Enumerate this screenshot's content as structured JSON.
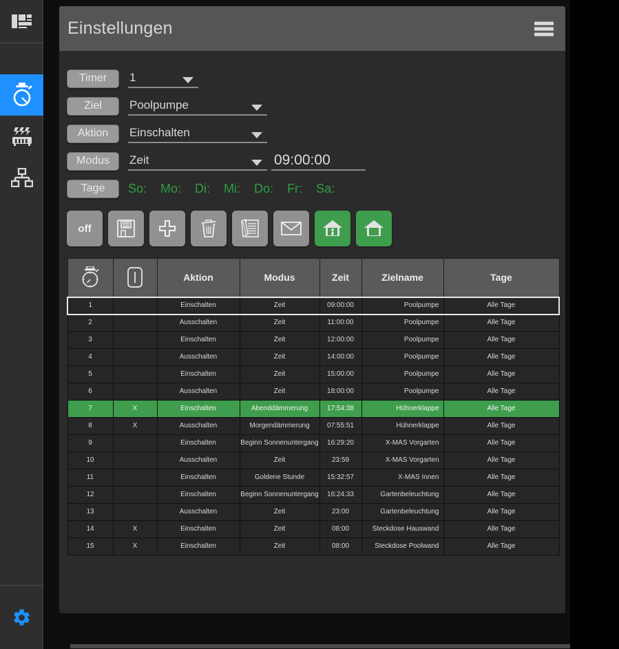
{
  "rail": {
    "items": [
      {
        "name": "dashboard",
        "icon": "dashboard-icon",
        "active": false
      },
      {
        "name": "timer",
        "icon": "stopwatch-icon",
        "active": true
      },
      {
        "name": "heating",
        "icon": "radiator-icon",
        "active": false
      },
      {
        "name": "network",
        "icon": "sitemap-icon",
        "active": false
      }
    ],
    "settings_icon": "gear-icon"
  },
  "header": {
    "title": "Einstellungen",
    "menu_icon": "hamburger-menu-icon"
  },
  "form": {
    "timer": {
      "label": "Timer",
      "value": "1"
    },
    "ziel": {
      "label": "Ziel",
      "value": "Poolpumpe"
    },
    "aktion": {
      "label": "Aktion",
      "value": "Einschalten"
    },
    "modus": {
      "label": "Modus",
      "value": "Zeit",
      "time": "09:00:00"
    },
    "tage": {
      "label": "Tage",
      "days": [
        "So:",
        "Mo:",
        "Di:",
        "Mi:",
        "Do:",
        "Fr:",
        "Sa:"
      ]
    }
  },
  "buttons": [
    {
      "name": "power-off-button",
      "label": "off",
      "icon": "text-off",
      "green": false
    },
    {
      "name": "save-button",
      "label": "",
      "icon": "floppy-disk-icon",
      "green": false
    },
    {
      "name": "add-button",
      "label": "",
      "icon": "plus-icon",
      "green": false
    },
    {
      "name": "delete-button",
      "label": "",
      "icon": "trash-icon",
      "green": false
    },
    {
      "name": "edit-log-button",
      "label": "",
      "icon": "notepad-pencil-icon",
      "green": false
    },
    {
      "name": "mail-button",
      "label": "",
      "icon": "envelope-icon",
      "green": false
    },
    {
      "name": "presence-home-button",
      "label": "",
      "icon": "house-person-icon",
      "green": true
    },
    {
      "name": "away-home-button",
      "label": "",
      "icon": "house-icon",
      "green": true
    }
  ],
  "table": {
    "headers": [
      "",
      "",
      "Aktion",
      "Modus",
      "Zeit",
      "Zielname",
      "Tage"
    ],
    "header_icons": [
      "stopwatch-icon",
      "switch-icon",
      "",
      "",
      "",
      "",
      ""
    ],
    "rows": [
      {
        "id": "1",
        "flag": "",
        "aktion": "Einschalten",
        "modus": "Zeit",
        "zeit": "09:00:00",
        "ziel": "Poolpumpe",
        "tage": "Alle Tage",
        "green": false,
        "selected": true
      },
      {
        "id": "2",
        "flag": "",
        "aktion": "Ausschalten",
        "modus": "Zeit",
        "zeit": "11:00:00",
        "ziel": "Poolpumpe",
        "tage": "Alle Tage",
        "green": false,
        "selected": false
      },
      {
        "id": "3",
        "flag": "",
        "aktion": "Einschalten",
        "modus": "Zeit",
        "zeit": "12:00:00",
        "ziel": "Poolpumpe",
        "tage": "Alle Tage",
        "green": false,
        "selected": false
      },
      {
        "id": "4",
        "flag": "",
        "aktion": "Ausschalten",
        "modus": "Zeit",
        "zeit": "14:00:00",
        "ziel": "Poolpumpe",
        "tage": "Alle Tage",
        "green": false,
        "selected": false
      },
      {
        "id": "5",
        "flag": "",
        "aktion": "Einschalten",
        "modus": "Zeit",
        "zeit": "15:00:00",
        "ziel": "Poolpumpe",
        "tage": "Alle Tage",
        "green": false,
        "selected": false
      },
      {
        "id": "6",
        "flag": "",
        "aktion": "Ausschalten",
        "modus": "Zeit",
        "zeit": "18:00:00",
        "ziel": "Poolpumpe",
        "tage": "Alle Tage",
        "green": false,
        "selected": false
      },
      {
        "id": "7",
        "flag": "X",
        "aktion": "Einschalten",
        "modus": "Abenddämmerung",
        "zeit": "17:54:38",
        "ziel": "Hühnerklappe",
        "tage": "Alle Tage",
        "green": true,
        "selected": false
      },
      {
        "id": "8",
        "flag": "X",
        "aktion": "Ausschalten",
        "modus": "Morgendämmerung",
        "zeit": "07:55:51",
        "ziel": "Hühnerklappe",
        "tage": "Alle Tage",
        "green": false,
        "selected": false
      },
      {
        "id": "9",
        "flag": "",
        "aktion": "Einschalten",
        "modus": "Beginn Sonnenuntergang",
        "zeit": "16:29:20",
        "ziel": "X-MAS Vorgarten",
        "tage": "Alle Tage",
        "green": false,
        "selected": false
      },
      {
        "id": "10",
        "flag": "",
        "aktion": "Ausschalten",
        "modus": "Zeit",
        "zeit": "23:59",
        "ziel": "X-MAS Vorgarten",
        "tage": "Alle Tage",
        "green": false,
        "selected": false
      },
      {
        "id": "11",
        "flag": "",
        "aktion": "Einschalten",
        "modus": "Goldene Stunde",
        "zeit": "15:32:57",
        "ziel": "X-MAS Innen",
        "tage": "Alle Tage",
        "green": false,
        "selected": false
      },
      {
        "id": "12",
        "flag": "",
        "aktion": "Einschalten",
        "modus": "Beginn Sonnenuntergang",
        "zeit": "16:24:33",
        "ziel": "Gartenbeleuchtung",
        "tage": "Alle Tage",
        "green": false,
        "selected": false
      },
      {
        "id": "13",
        "flag": "",
        "aktion": "Ausschalten",
        "modus": "Zeit",
        "zeit": "23:00",
        "ziel": "Gartenbeleuchtung",
        "tage": "Alle Tage",
        "green": false,
        "selected": false
      },
      {
        "id": "14",
        "flag": "X",
        "aktion": "Einschalten",
        "modus": "Zeit",
        "zeit": "08:00",
        "ziel": "Steckdose Hauswand",
        "tage": "Alle Tage",
        "green": false,
        "selected": false
      },
      {
        "id": "15",
        "flag": "X",
        "aktion": "Einschalten",
        "modus": "Zeit",
        "zeit": "08:00",
        "ziel": "Steckdose Poolwand",
        "tage": "Alle Tage",
        "green": false,
        "selected": false
      }
    ]
  },
  "colors": {
    "accent": "#1e90ff",
    "green": "#3f9e4d",
    "day_text": "#2f9e41",
    "titlebar": "#555555",
    "card": "#2b2b2b"
  }
}
